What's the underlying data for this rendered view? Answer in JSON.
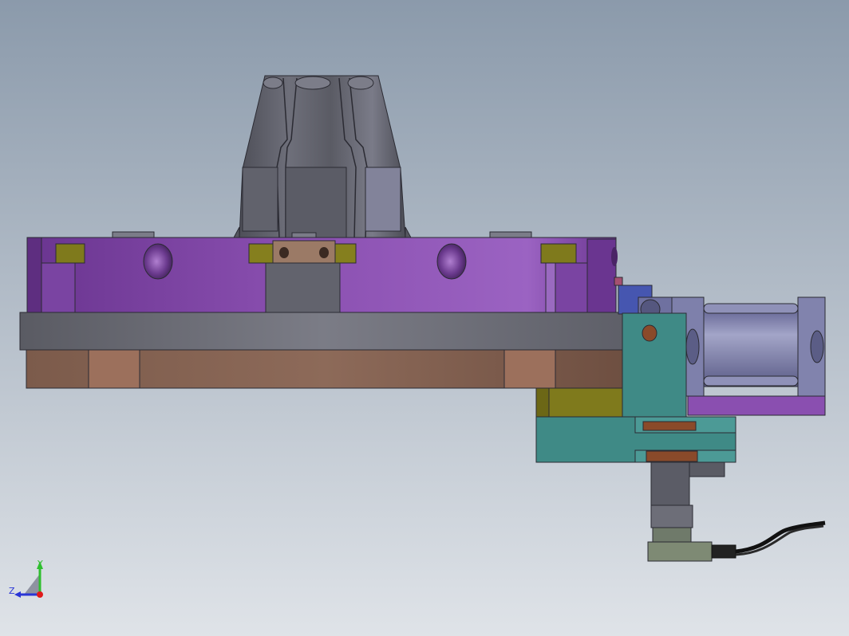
{
  "viewport": {
    "background_top": "#8b9aab",
    "background_bottom": "#dfe3e8"
  },
  "triad": {
    "axis_y_label": "Y",
    "axis_z_label": "Z",
    "axis_y_color": "#2fbf2f",
    "axis_z_color": "#2a35d6",
    "axis_x_color": "#e01a1a"
  },
  "colors": {
    "purple_body": "#8a4fb0",
    "steel_plate": "#6f7079",
    "brown_base": "#7a5a4a",
    "teal_block": "#3f8a86",
    "olive_block": "#7f7a1c",
    "gray_cone": "#6d6e78",
    "cylinder_lavender": "#8d8fb6"
  }
}
